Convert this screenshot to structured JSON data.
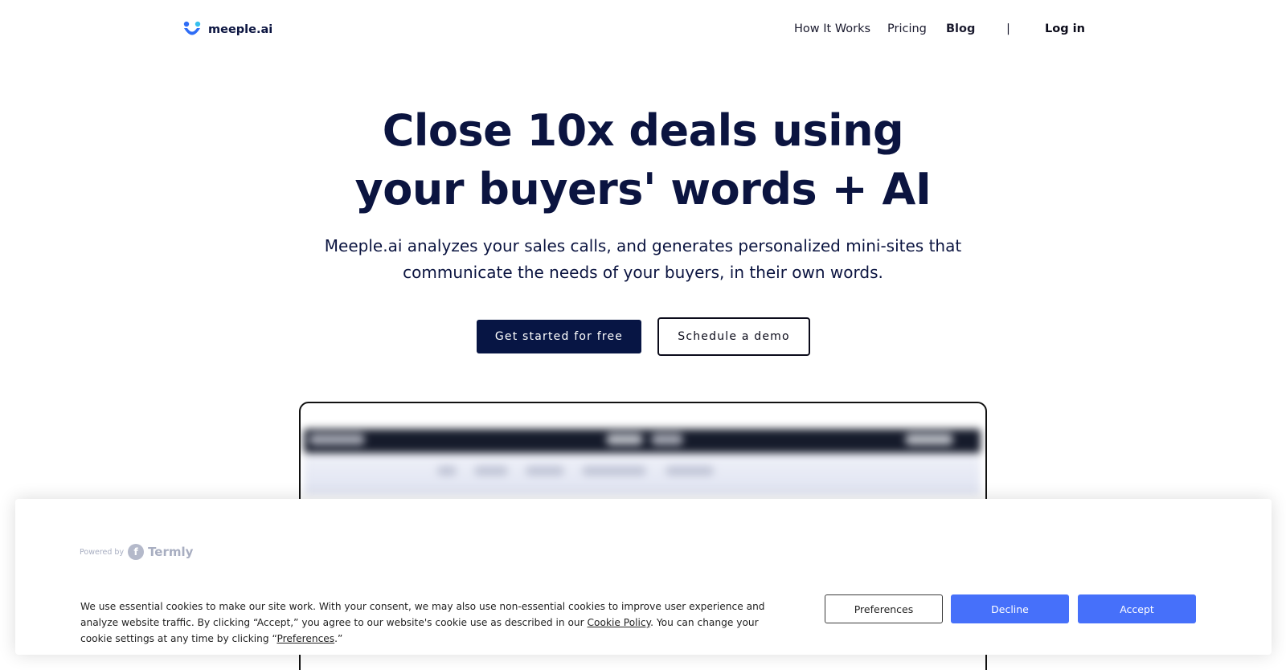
{
  "header": {
    "logo_text": "meeple.ai",
    "nav": {
      "how_it_works": "How It Works",
      "pricing": "Pricing",
      "blog": "Blog",
      "separator": "|",
      "login": "Log in"
    }
  },
  "hero": {
    "title_line1": "Close 10x deals using",
    "title_line2": "your buyers' words + AI",
    "subtitle_line1": "Meeple.ai analyzes your sales calls, and generates personalized mini-sites that",
    "subtitle_line2": "communicate the needs of your buyers, in their own words.",
    "primary_cta": "Get started for free",
    "secondary_cta": "Schedule a demo"
  },
  "cookie_banner": {
    "powered_by": "Powered by",
    "brand": "Termly",
    "brand_icon_letter": "f",
    "text_part1": "We use essential cookies to make our site work. With your consent, we may also use non-essential cookies to improve user experience and analyze website traffic. By clicking “Accept,” you agree to our website's cookie use as described in our ",
    "cookie_policy_link": "Cookie Policy",
    "text_part2": ". You can change your cookie settings at any time by clicking “",
    "preferences_link": "Preferences",
    "text_part3": ".”",
    "preferences_button": "Preferences",
    "decline_button": "Decline",
    "accept_button": "Accept"
  },
  "colors": {
    "navy": "#0b1440",
    "primary_button": "#071544",
    "cookie_accent": "#4670fa",
    "logo_blue": "#2f6df6",
    "logo_cyan": "#37c0ee"
  }
}
